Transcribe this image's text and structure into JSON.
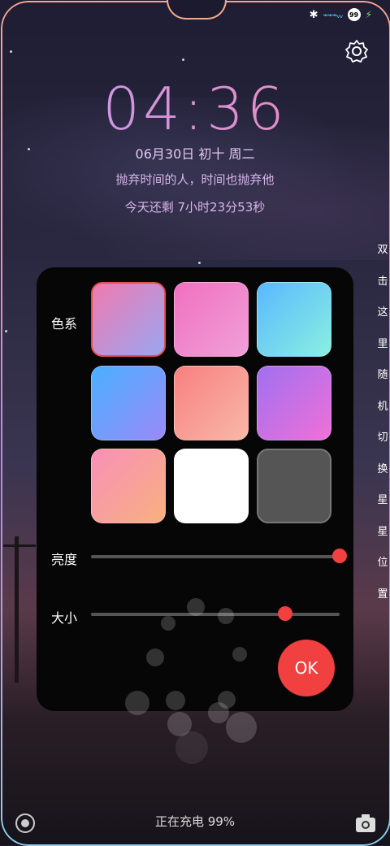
{
  "status": {
    "bluetooth_icon": "bluetooth-icon",
    "network_text": "⌁⌁⌁ᵥᵥ",
    "battery": "99",
    "charging_icon": "bolt-icon"
  },
  "lockscreen": {
    "time": "04:36",
    "date": "06月30日 初十 周二",
    "quote": "抛弃时间的人，时间也抛弃他",
    "remaining": "今天还剩 7小时23分53秒",
    "side_hint": [
      "双",
      "击",
      "这",
      "里",
      "随",
      "机",
      "切",
      "换",
      "星",
      "星",
      "位",
      "置"
    ],
    "charging": "正在充电 99%"
  },
  "panel": {
    "color_label": "色系",
    "brightness_label": "亮度",
    "size_label": "大小",
    "ok_label": "OK",
    "brightness_value": 1.0,
    "size_value": 0.78,
    "accent": "#f04040",
    "swatches": [
      {
        "name": "pink-purple",
        "from": "#f07ab0",
        "to": "#9aa6f2",
        "selected": true
      },
      {
        "name": "pink-magenta",
        "from": "#f070c0",
        "to": "#f0a0d8",
        "selected": false
      },
      {
        "name": "cyan-teal",
        "from": "#5ab8ff",
        "to": "#8af0e0",
        "selected": false
      },
      {
        "name": "blue-violet",
        "from": "#4ab0ff",
        "to": "#9a8af8",
        "selected": false
      },
      {
        "name": "peach-pink",
        "from": "#f88080",
        "to": "#f8b8a8",
        "selected": false
      },
      {
        "name": "purple-magenta",
        "from": "#a070f0",
        "to": "#f070d8",
        "selected": false
      },
      {
        "name": "peach-orange",
        "from": "#f890b8",
        "to": "#f8b080",
        "selected": false
      },
      {
        "name": "white",
        "from": "#ffffff",
        "to": "#ffffff",
        "selected": false
      },
      {
        "name": "dark-gray",
        "from": "#555555",
        "to": "#555555",
        "selected": false
      }
    ]
  }
}
